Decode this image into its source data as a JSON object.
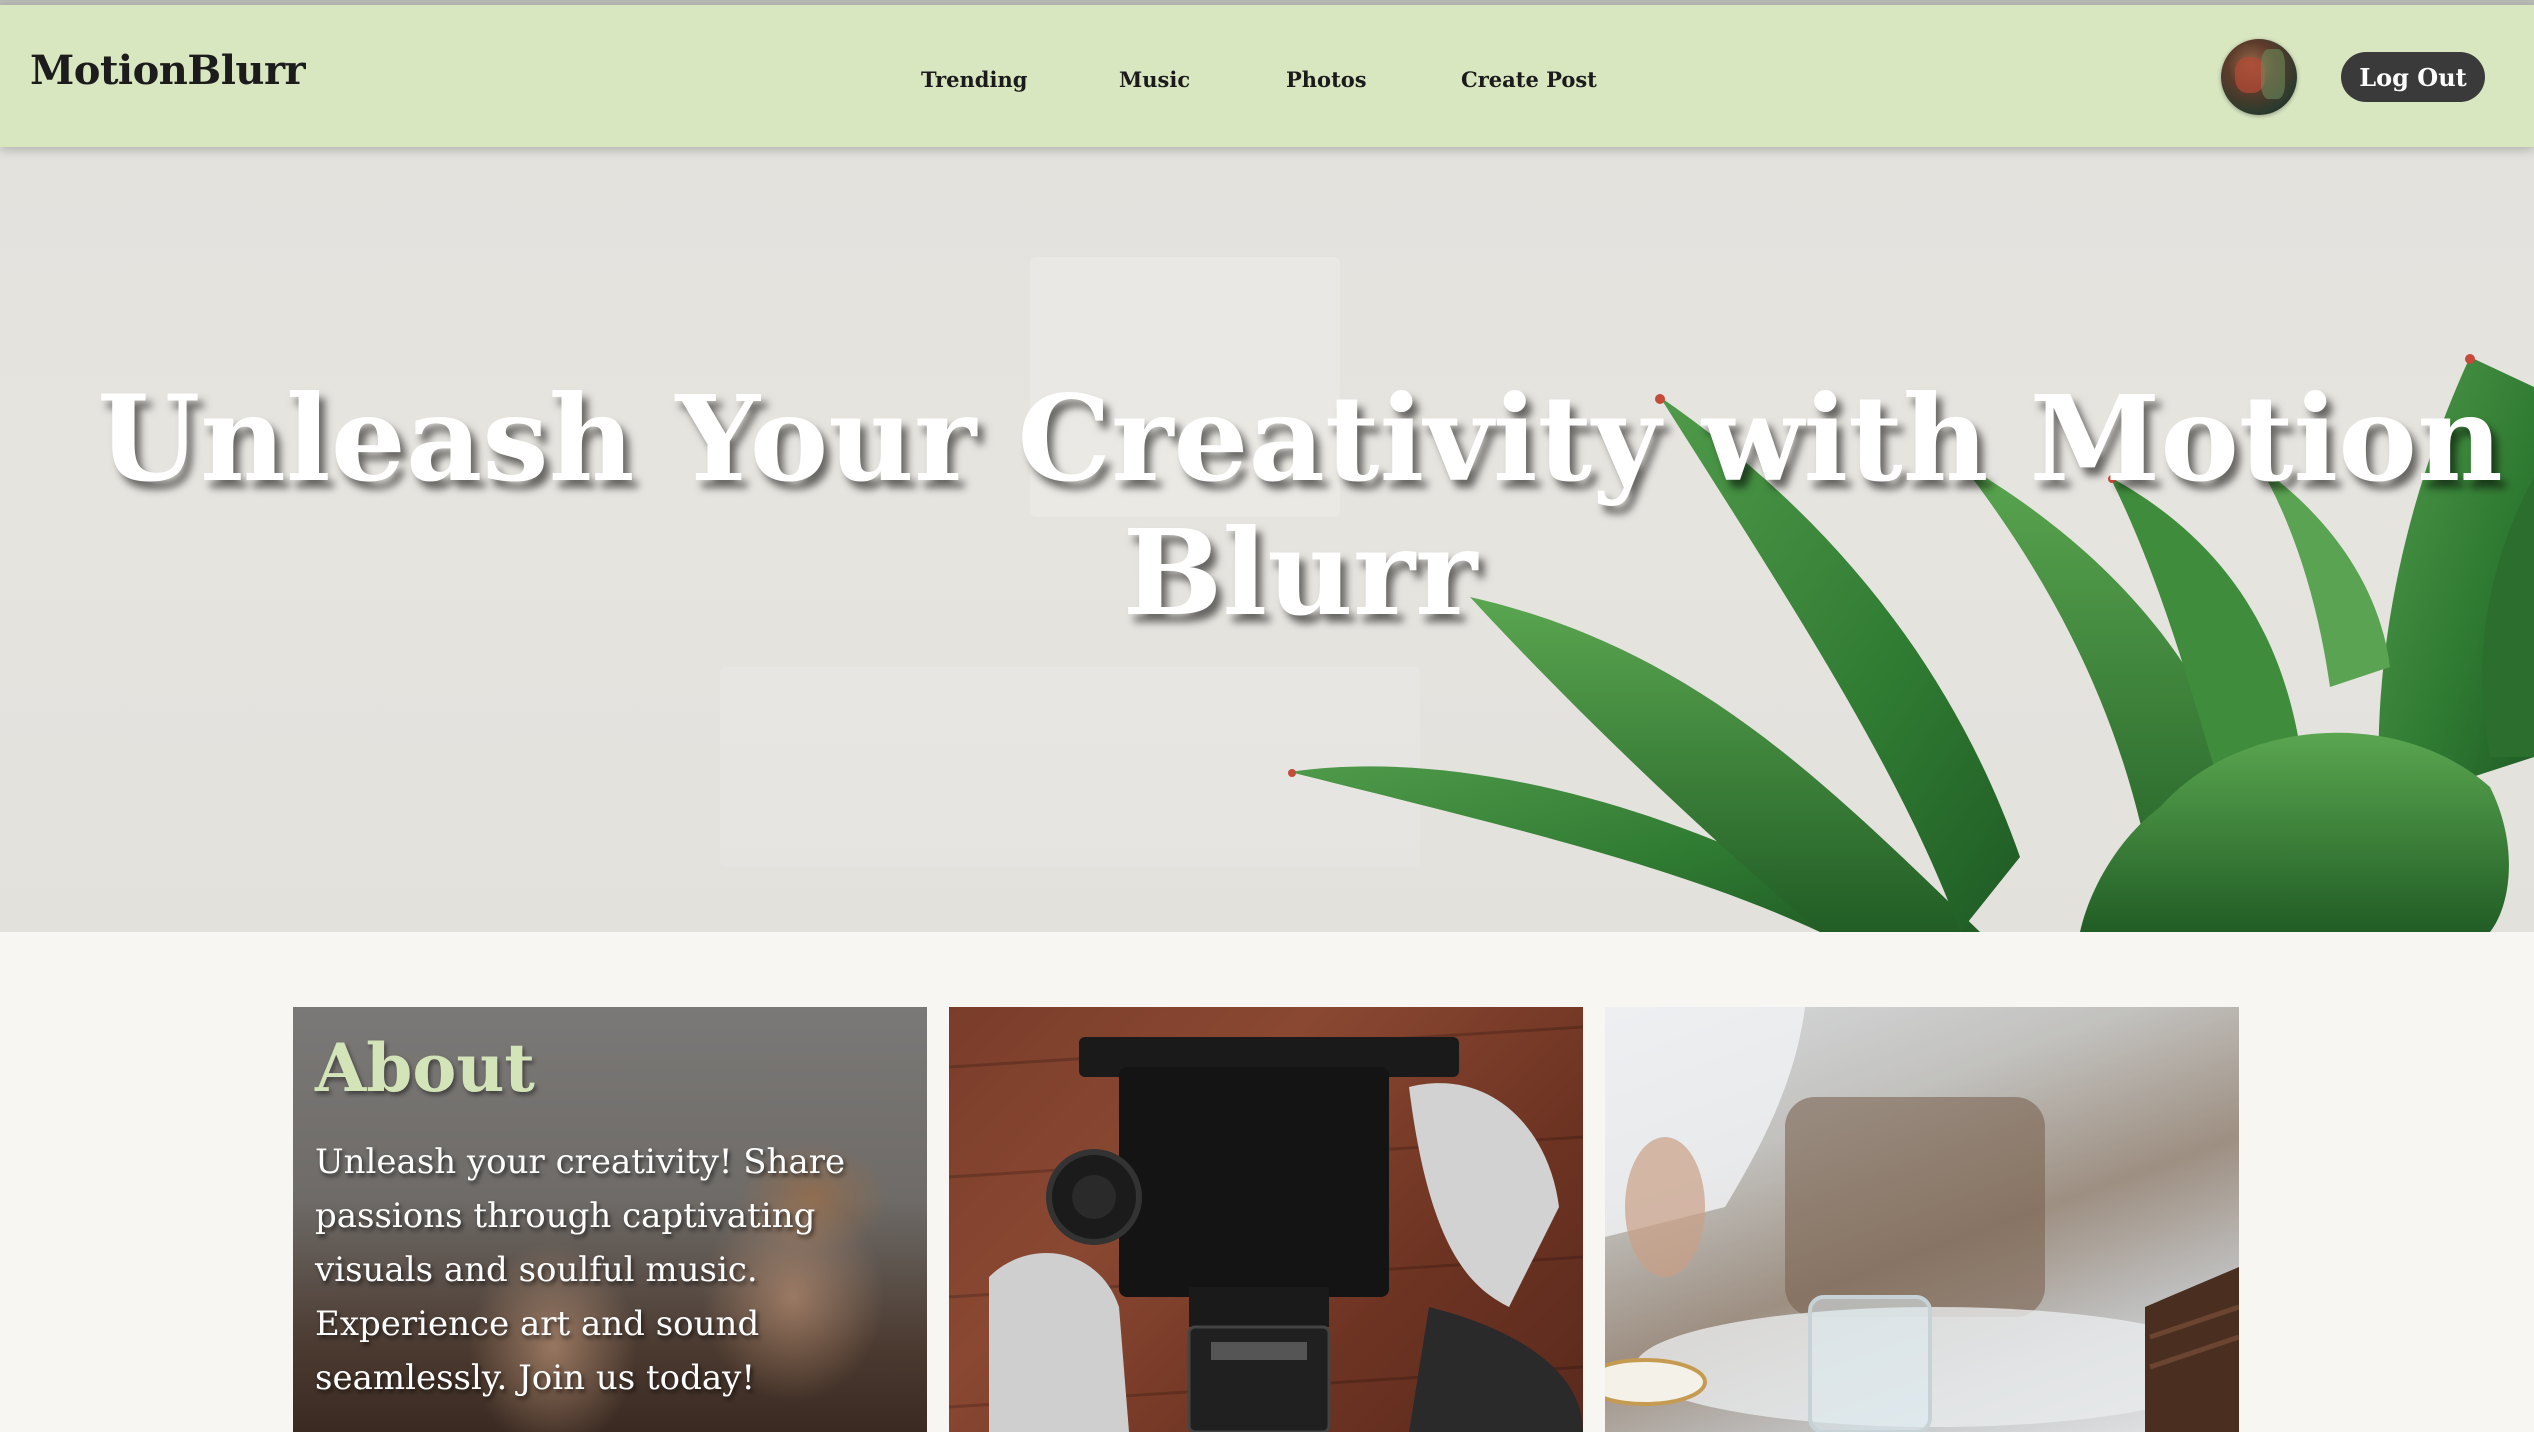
{
  "navbar": {
    "brand": "MotionBlurr",
    "links": [
      "Trending",
      "Music",
      "Photos",
      "Create Post"
    ],
    "logout_label": "Log Out"
  },
  "hero": {
    "title": "Unleash Your Creativity with Motion Blurr"
  },
  "cards": {
    "about": {
      "heading": "About",
      "text": "Unleash your creativity! Share passions through captivating visuals and soulful music. Experience art and sound seamlessly. Join us today!"
    }
  },
  "colors": {
    "navbar_bg": "#d9e7c1",
    "logout_bg": "#3a3a3a",
    "about_heading": "#d3e4b9",
    "page_bg": "#f8f6f2"
  },
  "icons": [
    "user-avatar",
    "succulent-plant-image",
    "camera-photo",
    "cafe-photo"
  ]
}
